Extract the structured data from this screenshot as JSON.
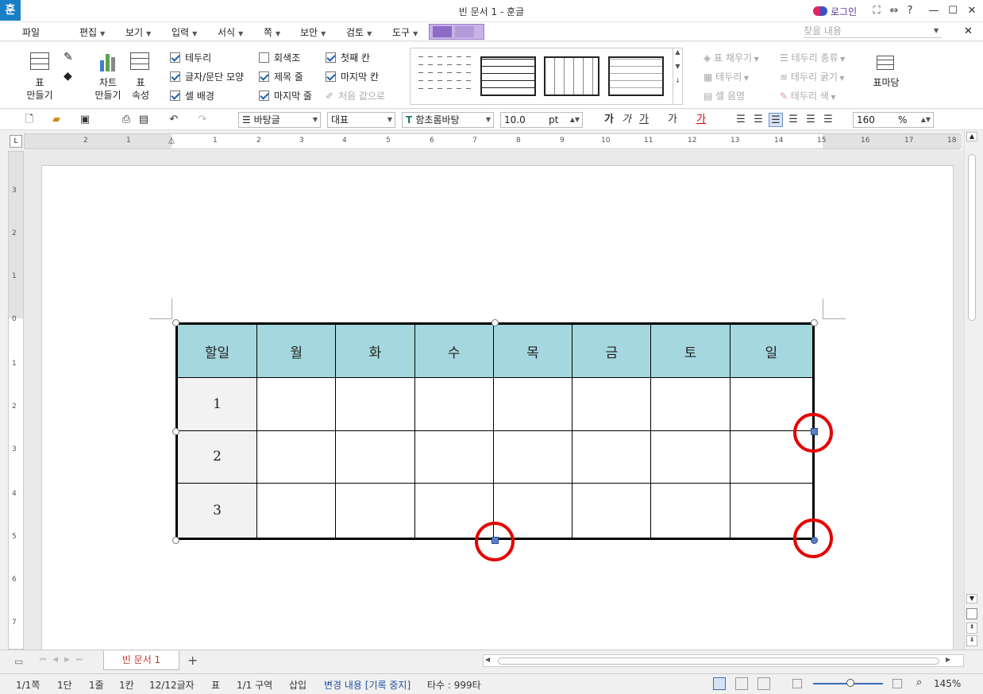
{
  "app": {
    "icon_letter": "훈",
    "title": "빈 문서 1 - 훈글",
    "login_label": "로그인"
  },
  "window_buttons": {
    "fit": "⛶",
    "split": "⇔",
    "help": "?",
    "min": "—",
    "max": "☐",
    "close": "✕"
  },
  "menu": {
    "file": "파일",
    "items": [
      "편집",
      "보기",
      "입력",
      "서식",
      "쪽",
      "보안",
      "검토",
      "도구"
    ],
    "search_placeholder": "찾을 내용",
    "close_doc": "✕"
  },
  "ribbon": {
    "table_make": "표\n만들기",
    "chart_make": "차트\n만들기",
    "table_props": "표\n속성",
    "checks": [
      {
        "label": "테두리",
        "checked": true
      },
      {
        "label": "글자/문단 모양",
        "checked": true
      },
      {
        "label": "셀 배경",
        "checked": true
      },
      {
        "label": "회색조",
        "checked": false
      },
      {
        "label": "제목 줄",
        "checked": true
      },
      {
        "label": "마지막 줄",
        "checked": true
      },
      {
        "label": "첫째 칸",
        "checked": true
      },
      {
        "label": "마지막 칸",
        "checked": true
      }
    ],
    "reset_label": "처음 값으로",
    "fill_label": "표 채우기",
    "border_label": "테두리",
    "cell_shade_label": "셀 음영",
    "border_type_label": "테두리 종류",
    "border_width_label": "테두리 굵기",
    "border_color_label": "테두리 색",
    "table_style_label": "표마당"
  },
  "toolbar": {
    "style_name": "바탕글",
    "lang": "대표",
    "font": "함초롬바탕",
    "font_size": "10.0",
    "size_unit": "pt",
    "zoom": "160",
    "zoom_unit": "%",
    "bold_glyph": "가",
    "italic_glyph": "가",
    "underline_glyph": "가",
    "strike_glyph": "가",
    "color_glyph": "가"
  },
  "ruler": {
    "h_ticks": [
      "2",
      "1",
      "1",
      "2",
      "3",
      "4",
      "5",
      "6",
      "7",
      "8",
      "9",
      "10",
      "11",
      "12",
      "13",
      "14",
      "15",
      "16",
      "17",
      "18"
    ],
    "v_ticks": [
      "3",
      "2",
      "1",
      "0",
      "1",
      "2",
      "3",
      "4",
      "5",
      "6",
      "7"
    ]
  },
  "table": {
    "header": [
      "할일",
      "월",
      "화",
      "수",
      "목",
      "금",
      "토",
      "일"
    ],
    "rows": [
      [
        "1",
        "",
        "",
        "",
        "",
        "",
        "",
        ""
      ],
      [
        "2",
        "",
        "",
        "",
        "",
        "",
        "",
        ""
      ],
      [
        "3",
        "",
        "",
        "",
        "",
        "",
        "",
        ""
      ]
    ],
    "header_color": "#a5d7de",
    "highlight_color": "#e60000"
  },
  "tabs": {
    "doc_tab": "빈 문서 1",
    "add": "+"
  },
  "status": {
    "page": "1/1쪽",
    "column": "1단",
    "line": "1줄",
    "col": "1칸",
    "chars": "12/12글자",
    "object": "표",
    "section": "1/1 구역",
    "mode": "삽입",
    "track": "변경 내용 [기록 중지]",
    "keystrokes": "타수 : 999타",
    "zoom": "145%"
  }
}
